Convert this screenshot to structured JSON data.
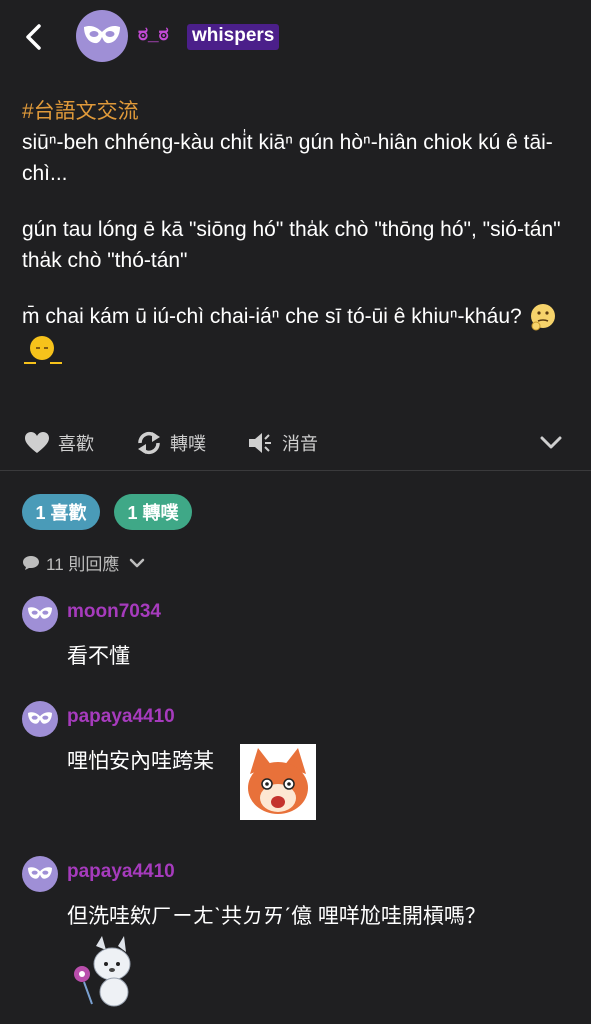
{
  "header": {
    "author": "ಠ_ಠ",
    "tag": "whispers"
  },
  "post": {
    "hashtag": "#台語文交流",
    "para1": "siūⁿ-beh chhéng-kàu chi̍t kiāⁿ gún hòⁿ-hiân chiok kú ê tāi-chì...",
    "para2": "gún tau lóng ē kā \"siōng hó\" tha̍k chò \"thōng hó\", \"sió-tán\" tha̍k chò \"thó-tán\"",
    "para3": "m̄ chai kám ū iú-chì chai-iáⁿ che sī tó-ūi ê khiuⁿ-kháu?"
  },
  "actions": {
    "like": "喜歡",
    "share": "轉噗",
    "mute": "消音"
  },
  "stats": {
    "likes": "1 喜歡",
    "shares": "1 轉噗",
    "replies": "11 則回應"
  },
  "comments": [
    {
      "name": "moon7034",
      "text": "看不懂"
    },
    {
      "name": "papaya4410",
      "text": "哩怕安內哇跨某"
    },
    {
      "name": "papaya4410",
      "text": "但洗哇欸ㄏㄧㄤˋ共ㄉㄞˊ億 哩咩尬哇開槓嗎？"
    }
  ],
  "colors": {
    "background": "#1f1f21",
    "username_purple": "#a63bbd",
    "hashtag_orange": "#e09a3a",
    "like_pill": "#4a9bb8",
    "share_pill": "#3fa887"
  }
}
